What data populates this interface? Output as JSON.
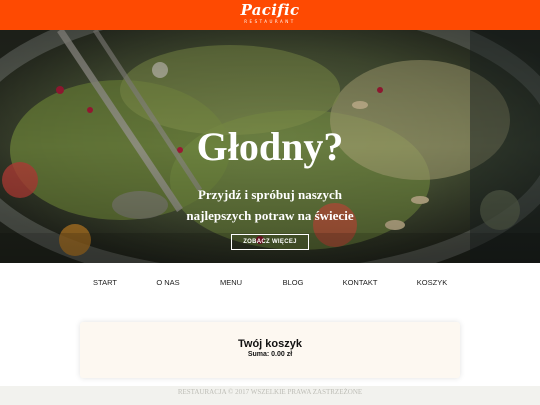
{
  "header": {
    "logo": "Pacific",
    "logo_sub": "RESTAURANT"
  },
  "hero": {
    "title": "Głodny?",
    "subtitle": "Przyjdź i spróbuj naszych najlepszych potraw na świecie",
    "button": "ZOBACZ WIĘCEJ"
  },
  "nav": {
    "items": [
      "START",
      "O NAS",
      "MENU",
      "BLOG",
      "KONTAKT",
      "KOSZYK"
    ]
  },
  "cart": {
    "title": "Twój koszyk",
    "sum": "Suma: 0.00 zł"
  },
  "footer": {
    "text": "RESTAURACJA © 2017 WSZELKIE PRAWA ZASTRZEŻONE"
  },
  "colors": {
    "brand": "#fe4a02",
    "card": "#fdf8f1",
    "footer": "#f2f2ee"
  }
}
